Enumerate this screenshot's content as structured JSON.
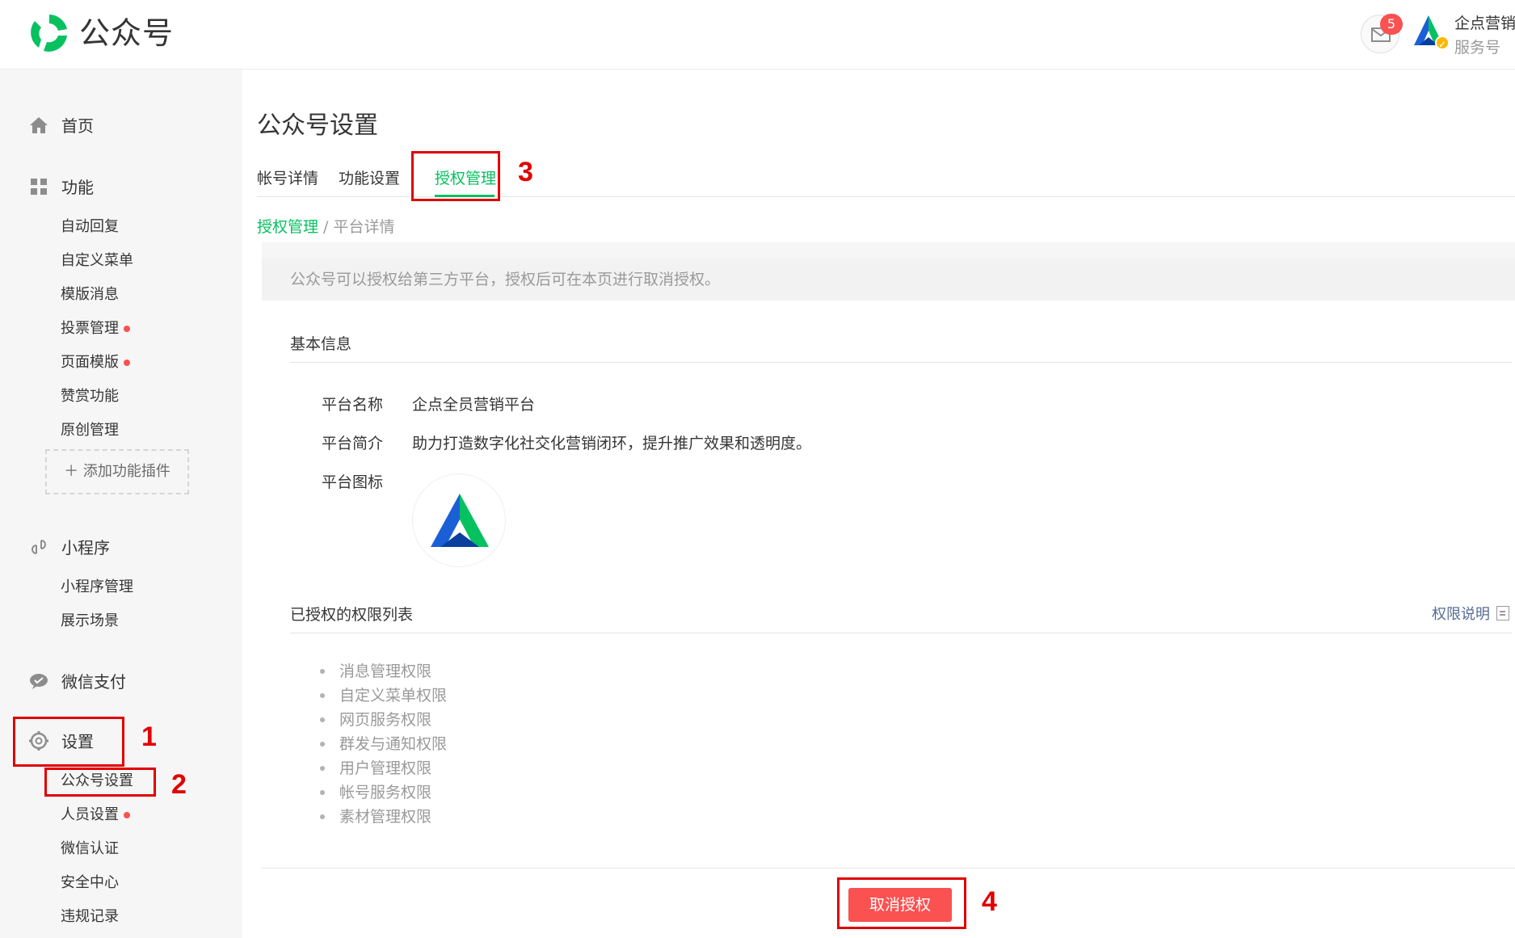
{
  "header": {
    "brand": "公众号",
    "logo_icon": "wechat-mp-logo-icon",
    "message_icon": "mail-icon",
    "message_count": "5",
    "account_name": "企点营销",
    "account_type": "服务号",
    "brand_color": "#07c160"
  },
  "sidebar": {
    "groups": [
      {
        "label": "首页",
        "icon": "home-icon"
      },
      {
        "label": "功能",
        "icon": "grid-icon"
      },
      {
        "label": "小程序",
        "icon": "link-icon"
      },
      {
        "label": "微信支付",
        "icon": "chat-bubble-icon"
      },
      {
        "label": "设置",
        "icon": "gear-icon"
      }
    ],
    "function_items": [
      "自动回复",
      "自定义菜单",
      "模版消息",
      "投票管理",
      "页面模版",
      "赞赏功能",
      "原创管理"
    ],
    "add_plugin": "添加功能插件",
    "miniprogram_items": [
      "小程序管理",
      "展示场景"
    ],
    "settings_items": [
      "公众号设置",
      "人员设置",
      "微信认证",
      "安全中心",
      "违规记录"
    ]
  },
  "main": {
    "title": "公众号设置",
    "tabs": [
      "帐号详情",
      "功能设置",
      "授权管理"
    ],
    "breadcrumb": {
      "link": "授权管理",
      "separator": " / ",
      "current": "平台详情"
    },
    "notice": "公众号可以授权给第三方平台，授权后可在本页进行取消授权。",
    "basic_info_title": "基本信息",
    "fields": {
      "name_label": "平台名称",
      "name_value": "企点全员营销平台",
      "desc_label": "平台简介",
      "desc_value": "助力打造数字化社交化营销闭环，提升推广效果和透明度。",
      "icon_label": "平台图标"
    },
    "permissions_title": "已授权的权限列表",
    "permissions_help": "权限说明",
    "permissions": [
      "消息管理权限",
      "自定义菜单权限",
      "网页服务权限",
      "群发与通知权限",
      "用户管理权限",
      "帐号服务权限",
      "素材管理权限"
    ],
    "revoke_button": "取消授权",
    "danger_color": "#fa5151"
  },
  "annotations": [
    "1",
    "2",
    "3",
    "4"
  ]
}
